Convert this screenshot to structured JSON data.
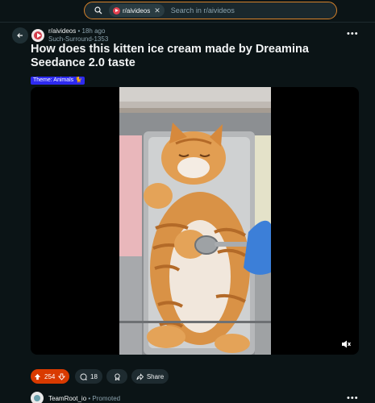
{
  "search": {
    "community_chip": "r/aivideos",
    "placeholder": "Search in r/aivideos",
    "chip_close": "✕"
  },
  "post": {
    "subreddit": "r/aivideos",
    "separator": "•",
    "age": "18h ago",
    "author": "Such-Surround-1353",
    "title": "How does this kitten ice cream made by Dreamina Seedance 2.0 taste",
    "flair": "Theme: Animals 🐈",
    "more": "•••"
  },
  "actions": {
    "vote_count": "254",
    "comment_count": "18",
    "share_label": "Share"
  },
  "promoted": {
    "user": "TeamRoot_io",
    "separator": "•",
    "tag": "Promoted",
    "more": "•••"
  },
  "colors": {
    "background": "#0b1416",
    "search_border": "#d6822a",
    "upvote": "#d93a00",
    "flair": "#2d2af0"
  },
  "icons": {
    "search": "search-icon",
    "back": "arrow-left-icon",
    "upvote": "arrow-up-icon",
    "downvote": "arrow-down-icon",
    "comments": "comment-bubble-icon",
    "award": "award-icon",
    "share": "share-arrow-icon",
    "mute": "speaker-muted-icon"
  }
}
